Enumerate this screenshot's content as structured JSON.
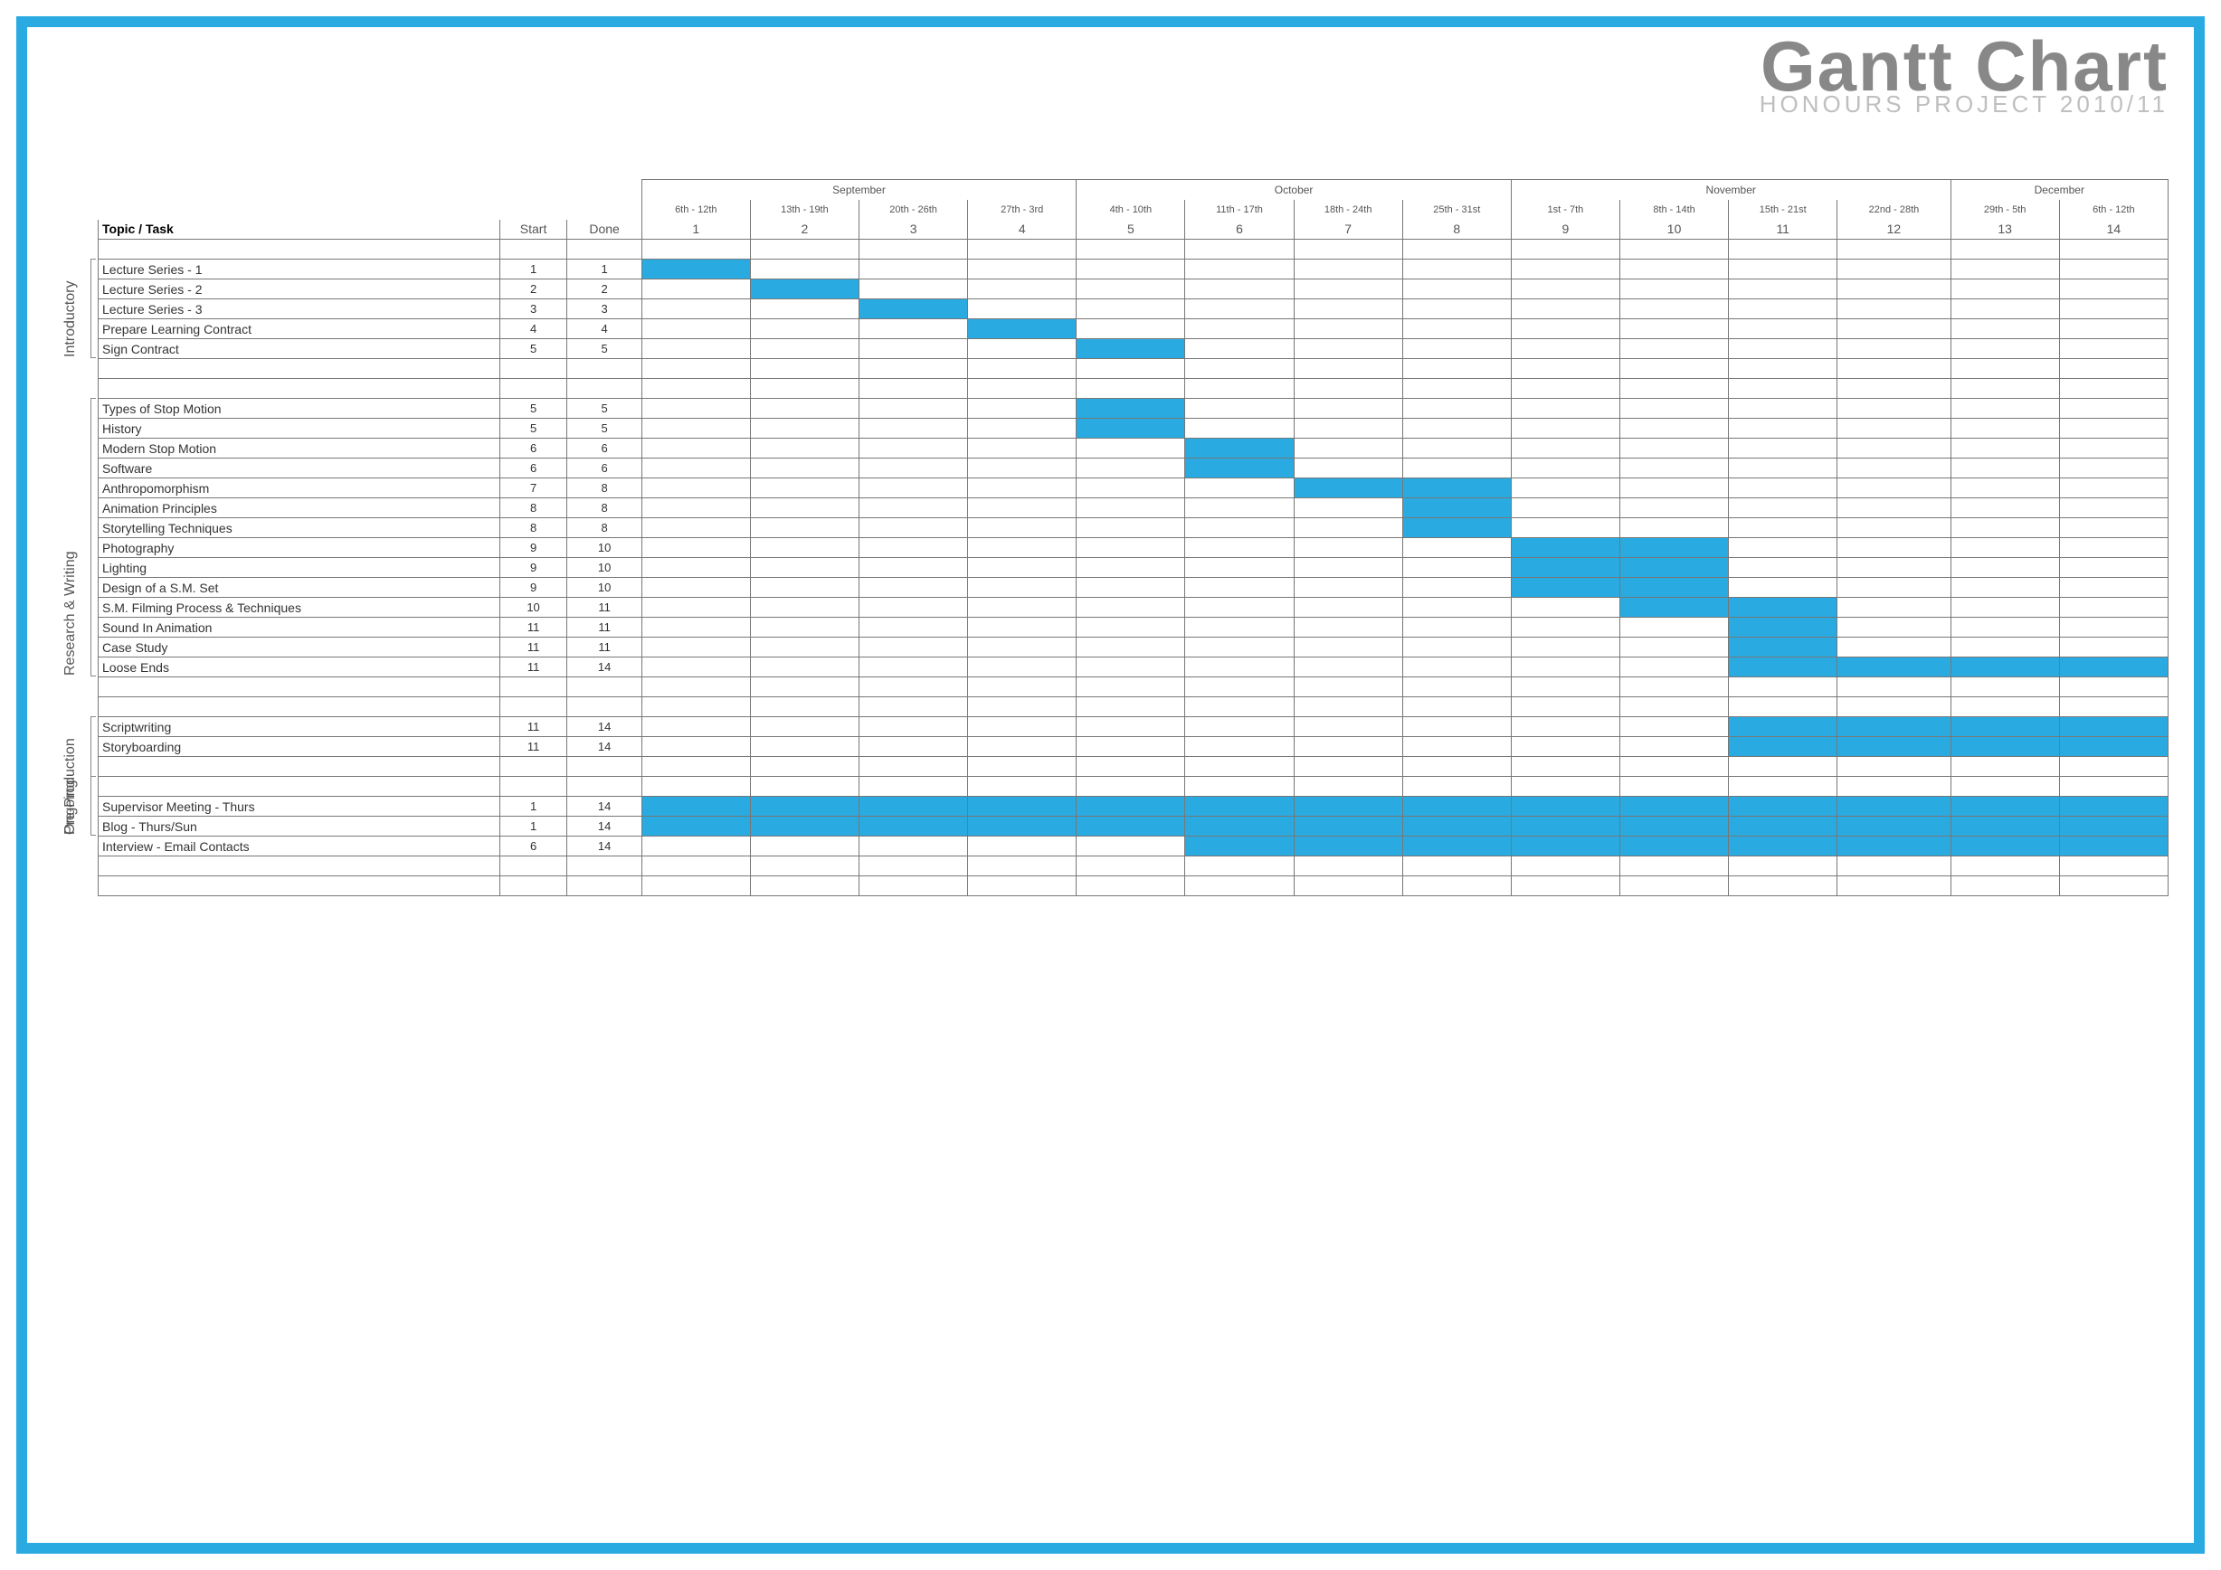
{
  "title": "Gantt Chart",
  "subtitle": "HONOURS PROJECT 2010/11",
  "header": {
    "topic_label": "Topic / Task",
    "start_label": "Start",
    "done_label": "Done",
    "months": [
      {
        "name": "September",
        "span": 4
      },
      {
        "name": "October",
        "span": 4
      },
      {
        "name": "November",
        "span": 4
      },
      {
        "name": "December",
        "span": 2
      }
    ],
    "week_ranges": [
      "6th - 12th",
      "13th - 19th",
      "20th - 26th",
      "27th - 3rd",
      "4th - 10th",
      "11th - 17th",
      "18th - 24th",
      "25th - 31st",
      "1st - 7th",
      "8th - 14th",
      "15th - 21st",
      "22nd - 28th",
      "29th - 5th",
      "6th - 12th"
    ],
    "week_numbers": [
      1,
      2,
      3,
      4,
      5,
      6,
      7,
      8,
      9,
      10,
      11,
      12,
      13,
      14
    ]
  },
  "groups": [
    {
      "name": "Introductory",
      "first_row": 0,
      "row_count": 5
    },
    {
      "name": "Research & Writing",
      "first_row": 7,
      "row_count": 14
    },
    {
      "name": "Pre-Production",
      "first_row": 23,
      "row_count": 6
    },
    {
      "name": "Ongoing",
      "first_row": 26,
      "row_count": 3
    }
  ],
  "chart_data": {
    "type": "gantt",
    "weeks": 14,
    "tasks": [
      {
        "name": "Lecture Series - 1",
        "start": 1,
        "done": 1,
        "bar": [
          1,
          1
        ]
      },
      {
        "name": "Lecture Series - 2",
        "start": 2,
        "done": 2,
        "bar": [
          2,
          2
        ]
      },
      {
        "name": "Lecture Series - 3",
        "start": 3,
        "done": 3,
        "bar": [
          3,
          3
        ]
      },
      {
        "name": "Prepare Learning Contract",
        "start": 4,
        "done": 4,
        "bar": [
          4,
          4
        ]
      },
      {
        "name": "Sign Contract",
        "start": 5,
        "done": 5,
        "bar": [
          5,
          5
        ]
      },
      {
        "gap": true
      },
      {
        "gap": true
      },
      {
        "name": "Types of Stop Motion",
        "start": 5,
        "done": 5,
        "bar": [
          5,
          5
        ]
      },
      {
        "name": "History",
        "start": 5,
        "done": 5,
        "bar": [
          5,
          5
        ]
      },
      {
        "name": "Modern Stop Motion",
        "start": 6,
        "done": 6,
        "bar": [
          6,
          6
        ]
      },
      {
        "name": "Software",
        "start": 6,
        "done": 6,
        "bar": [
          6,
          6
        ]
      },
      {
        "name": "Anthropomorphism",
        "start": 7,
        "done": 8,
        "bar": [
          7,
          8
        ]
      },
      {
        "name": "Animation Principles",
        "start": 8,
        "done": 8,
        "bar": [
          8,
          8
        ]
      },
      {
        "name": "Storytelling Techniques",
        "start": 8,
        "done": 8,
        "bar": [
          8,
          8
        ]
      },
      {
        "name": "Photography",
        "start": 9,
        "done": 10,
        "bar": [
          9,
          10
        ]
      },
      {
        "name": "Lighting",
        "start": 9,
        "done": 10,
        "bar": [
          9,
          10
        ]
      },
      {
        "name": "Design of a S.M. Set",
        "start": 9,
        "done": 10,
        "bar": [
          9,
          10
        ]
      },
      {
        "name": "S.M. Filming Process & Techniques",
        "start": 10,
        "done": 11,
        "bar": [
          10,
          11
        ]
      },
      {
        "name": "Sound In Animation",
        "start": 11,
        "done": 11,
        "bar": [
          11,
          11
        ]
      },
      {
        "name": "Case Study",
        "start": 11,
        "done": 11,
        "bar": [
          11,
          11
        ]
      },
      {
        "name": "Loose Ends",
        "start": 11,
        "done": 14,
        "bar": [
          11,
          14
        ]
      },
      {
        "gap": true
      },
      {
        "gap": true
      },
      {
        "name": "Scriptwriting",
        "start": 11,
        "done": 14,
        "bar": [
          11,
          14
        ]
      },
      {
        "name": "Storyboarding",
        "start": 11,
        "done": 14,
        "bar": [
          11,
          14
        ]
      },
      {
        "gap": true
      },
      {
        "gap": true
      },
      {
        "name": "Supervisor Meeting - Thurs",
        "start": 1,
        "done": 14,
        "bar": [
          1,
          14
        ]
      },
      {
        "name": "Blog - Thurs/Sun",
        "start": 1,
        "done": 14,
        "bar": [
          1,
          14
        ]
      },
      {
        "name": "Interview - Email Contacts",
        "start": 6,
        "done": 14,
        "bar": [
          6,
          14
        ]
      },
      {
        "gap": true
      },
      {
        "gap": true
      }
    ]
  }
}
